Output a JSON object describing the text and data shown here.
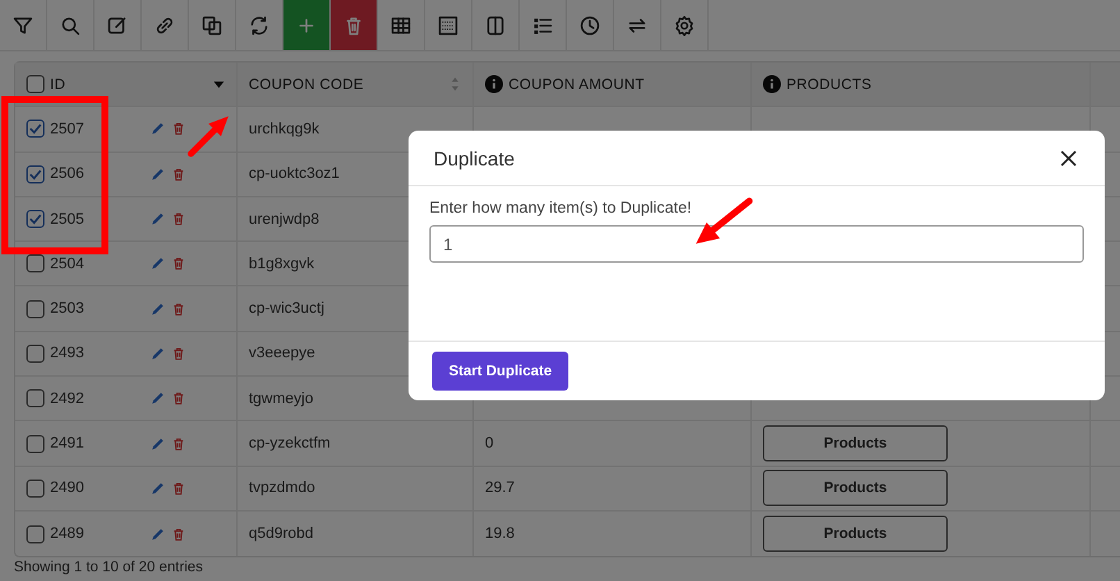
{
  "toolbar": [
    {
      "kind": "plain"
    },
    {
      "kind": "plain"
    },
    {
      "kind": "plain"
    },
    {
      "kind": "plain"
    },
    {
      "kind": "plain"
    },
    {
      "kind": "plain"
    },
    {
      "kind": "add"
    },
    {
      "kind": "delete"
    },
    {
      "kind": "plain"
    },
    {
      "kind": "plain"
    },
    {
      "kind": "plain"
    },
    {
      "kind": "plain"
    },
    {
      "kind": "plain"
    },
    {
      "kind": "plain"
    },
    {
      "kind": "plain"
    }
  ],
  "table": {
    "header_checked": false,
    "columns": [
      {
        "label": "ID",
        "info": false,
        "sortable": true,
        "sorted": true
      },
      {
        "label": "COUPON CODE",
        "info": false,
        "sortable": true,
        "sorted": false
      },
      {
        "label": "COUPON AMOUNT",
        "info": true,
        "sortable": false
      },
      {
        "label": "PRODUCTS",
        "info": true,
        "sortable": false
      }
    ],
    "rows": [
      {
        "selected": true,
        "id": "2507",
        "code": "urchkqg9k"
      },
      {
        "selected": true,
        "id": "2506",
        "code": "cp-uoktc3oz1"
      },
      {
        "selected": true,
        "id": "2505",
        "code": "urenjwdp8"
      },
      {
        "selected": false,
        "id": "2504",
        "code": "b1g8xgvk"
      },
      {
        "selected": false,
        "id": "2503",
        "code": "cp-wic3uctj"
      },
      {
        "selected": false,
        "id": "2493",
        "code": "v3eeepye"
      },
      {
        "selected": false,
        "id": "2492",
        "code": "tgwmeyjo"
      },
      {
        "selected": false,
        "id": "2491",
        "code": "cp-yzekctfm",
        "amount": "0",
        "products": "Products"
      },
      {
        "selected": false,
        "id": "2490",
        "code": "tvpzdmdo",
        "amount": "29.7",
        "products": "Products"
      },
      {
        "selected": false,
        "id": "2489",
        "code": "q5d9robd",
        "amount": "19.8",
        "products": "Products"
      }
    ]
  },
  "footer": "Showing 1 to 10 of 20 entries",
  "modal": {
    "title": "Duplicate",
    "prompt": "Enter how many item(s) to Duplicate!",
    "value": "1",
    "button": "Start Duplicate"
  }
}
